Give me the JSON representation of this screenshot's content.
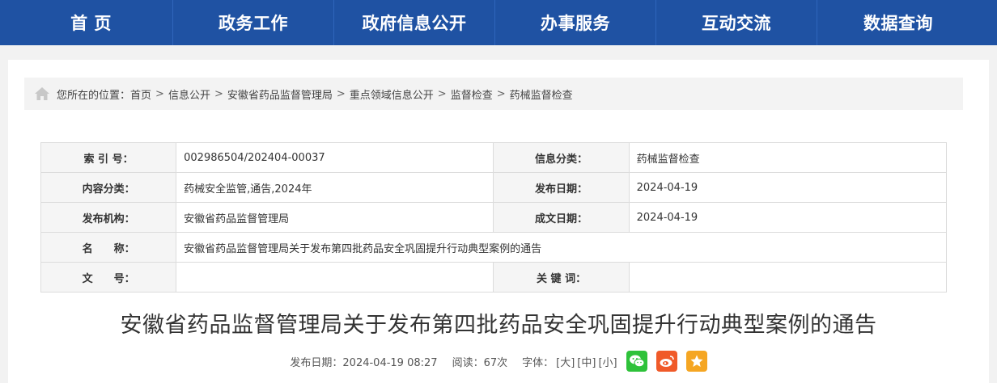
{
  "nav": {
    "items": [
      "首 页",
      "政务工作",
      "政府信息公开",
      "办事服务",
      "互动交流",
      "数据查询"
    ]
  },
  "breadcrumb": {
    "prefix": "您所在的位置：",
    "items": [
      "首页",
      "信息公开",
      "安徽省药品监督管理局",
      "重点领域信息公开",
      "监督检查",
      "药械监督检查"
    ],
    "separator": ">"
  },
  "info": {
    "index_label": "索 引 号：",
    "index_value": "002986504/202404-00037",
    "category_label": "信息分类：",
    "category_value": "药械监督检查",
    "content_label": "内容分类：",
    "content_value": "药械安全监管,通告,2024年",
    "publish_date_label": "发布日期：",
    "publish_date_value": "2024-04-19",
    "org_label": "发布机构：",
    "org_value": "安徽省药品监督管理局",
    "written_date_label": "成文日期：",
    "written_date_value": "2024-04-19",
    "name_label": "名　　称：",
    "name_value": "安徽省药品监督管理局关于发布第四批药品安全巩固提升行动典型案例的通告",
    "doc_no_label": "文　　号：",
    "doc_no_value": "",
    "keywords_label": "关 键 词：",
    "keywords_value": ""
  },
  "article": {
    "title": "安徽省药品监督管理局关于发布第四批药品安全巩固提升行动典型案例的通告"
  },
  "meta": {
    "publish": "发布日期：2024-04-19 08:27",
    "reads": "阅读：67次",
    "font_label": "字体：",
    "font_large": "[大]",
    "font_medium": "[中]",
    "font_small": "[小]"
  },
  "colors": {
    "nav_bg": "#1f52a3",
    "wechat": "#2ec23a",
    "weibo": "#f05a29",
    "favorite": "#f5a623"
  },
  "icons": [
    "home-icon",
    "wechat-icon",
    "weibo-icon",
    "favorite-icon"
  ]
}
